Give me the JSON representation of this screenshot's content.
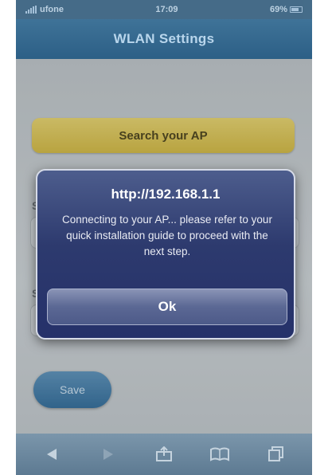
{
  "status_bar": {
    "carrier": "ufone",
    "time": "17:09",
    "battery": "69%"
  },
  "nav": {
    "title": "WLAN Settings"
  },
  "main": {
    "search_ap_label": "Search your AP",
    "field_label_1": "S",
    "field_label_2": "S",
    "save_label": "Save"
  },
  "alert": {
    "title": "http://192.168.1.1",
    "message": "Connecting to your AP... please refer to your quick installation guide to proceed with the next step.",
    "ok_label": "Ok"
  },
  "toolbar": {
    "icons": [
      "back-icon",
      "forward-icon",
      "share-icon",
      "bookmarks-icon",
      "tabs-icon"
    ]
  },
  "colors": {
    "nav_blue": "#2c5f86",
    "alert_navy": "#25316a",
    "search_yellow": "#d4b83e"
  }
}
